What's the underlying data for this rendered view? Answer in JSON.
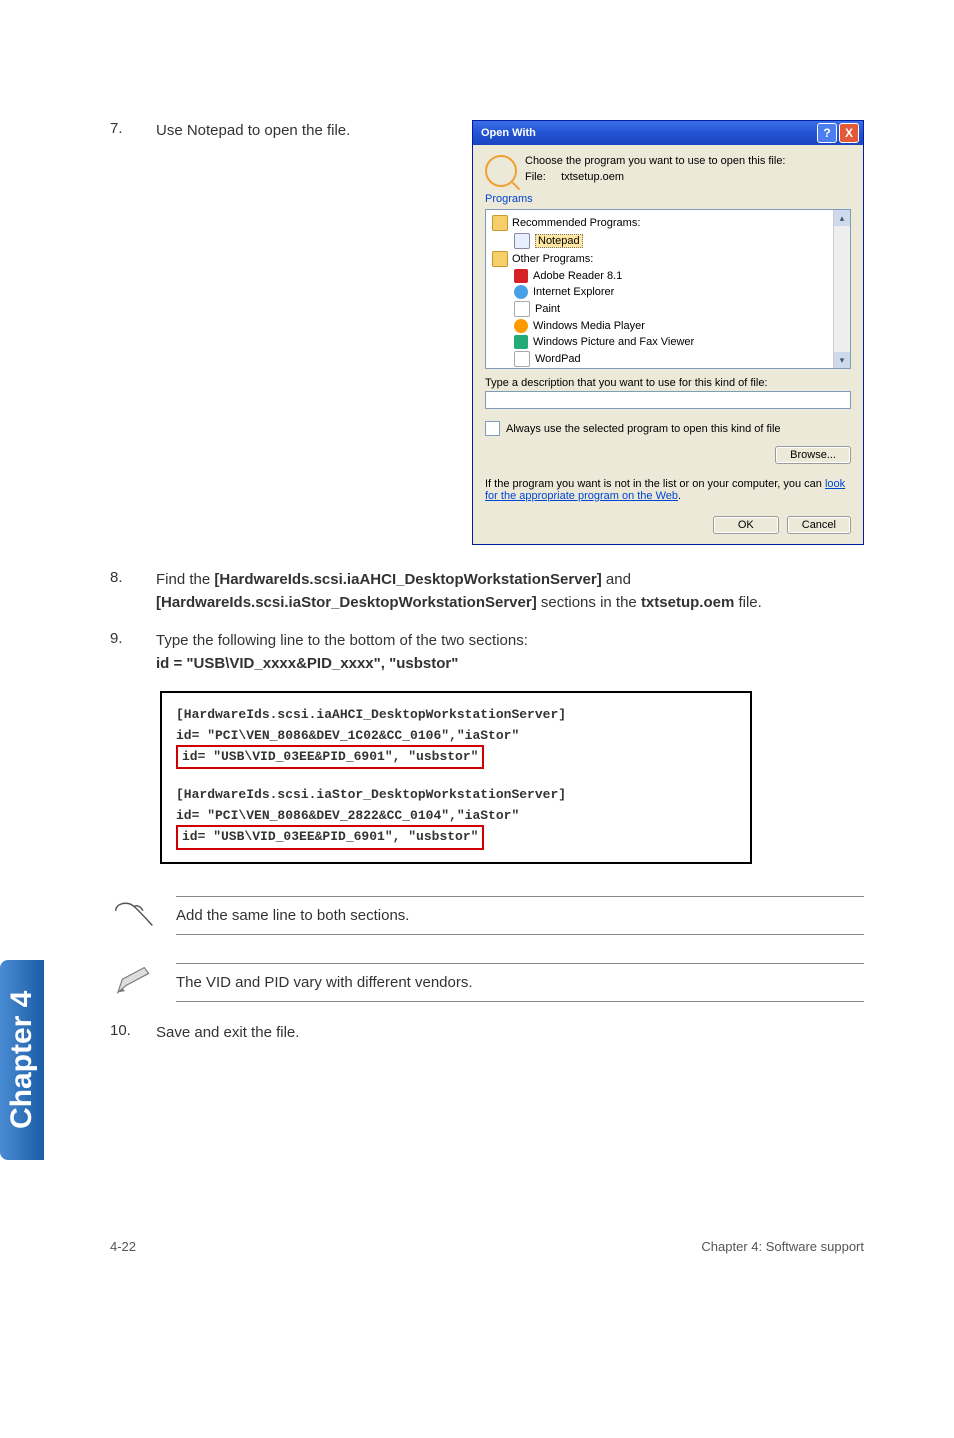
{
  "steps": {
    "s7": {
      "num": "7.",
      "text": "Use Notepad to open the file."
    },
    "s8": {
      "num": "8.",
      "prefix": "Find the ",
      "b1": "[HardwareIds.scsi.iaAHCI_DesktopWorkstationServer]",
      "mid": " and ",
      "b2": "[HardwareIds.scsi.iaStor_DesktopWorkstationServer]",
      "mid2": " sections in the ",
      "b3": "txtsetup.oem",
      "suffix": " file."
    },
    "s9": {
      "num": "9.",
      "line1": "Type the following line to the bottom of the two sections:",
      "line2": "id = \"USB\\VID_xxxx&PID_xxxx\", \"usbstor\""
    },
    "s10": {
      "num": "10.",
      "text": "Save and exit the file."
    }
  },
  "dialog": {
    "title": "Open With",
    "choose": "Choose the program you want to use to open this file:",
    "file_label": "File:",
    "file_name": "txtsetup.oem",
    "programs_label": "Programs",
    "group_rec": "Recommended Programs:",
    "item_notepad": "Notepad",
    "group_other": "Other Programs:",
    "item_adobe": "Adobe Reader 8.1",
    "item_ie": "Internet Explorer",
    "item_paint": "Paint",
    "item_wmp": "Windows Media Player",
    "item_pic": "Windows Picture and Fax Viewer",
    "item_wordpad": "WordPad",
    "desc_label": "Type a description that you want to use for this kind of file:",
    "always": "Always use the selected program to open this kind of file",
    "browse": "Browse...",
    "not_in_list_pre": "If the program you want is not in the list or on your computer, you can ",
    "not_in_list_link": "look for the appropriate program on the Web",
    "not_in_list_post": ".",
    "ok": "OK",
    "cancel": "Cancel",
    "help_btn": "?",
    "close_btn": "X"
  },
  "code": {
    "l1": "[HardwareIds.scsi.iaAHCI_DesktopWorkstationServer]",
    "l2": "id= \"PCI\\VEN_8086&DEV_1C02&CC_0106\",\"iaStor\"",
    "l3": "id= \"USB\\VID_03EE&PID_6901\", \"usbstor\"",
    "l4": "[HardwareIds.scsi.iaStor_DesktopWorkstationServer]",
    "l5": "id= \"PCI\\VEN_8086&DEV_2822&CC_0104\",\"iaStor\"",
    "l6": "id= \"USB\\VID_03EE&PID_6901\", \"usbstor\""
  },
  "notes": {
    "n1": "Add the same line to both sections.",
    "n2": "The VID and PID vary with different vendors."
  },
  "side_tab": "Chapter 4",
  "footer": {
    "left": "4-22",
    "right": "Chapter 4: Software support"
  }
}
